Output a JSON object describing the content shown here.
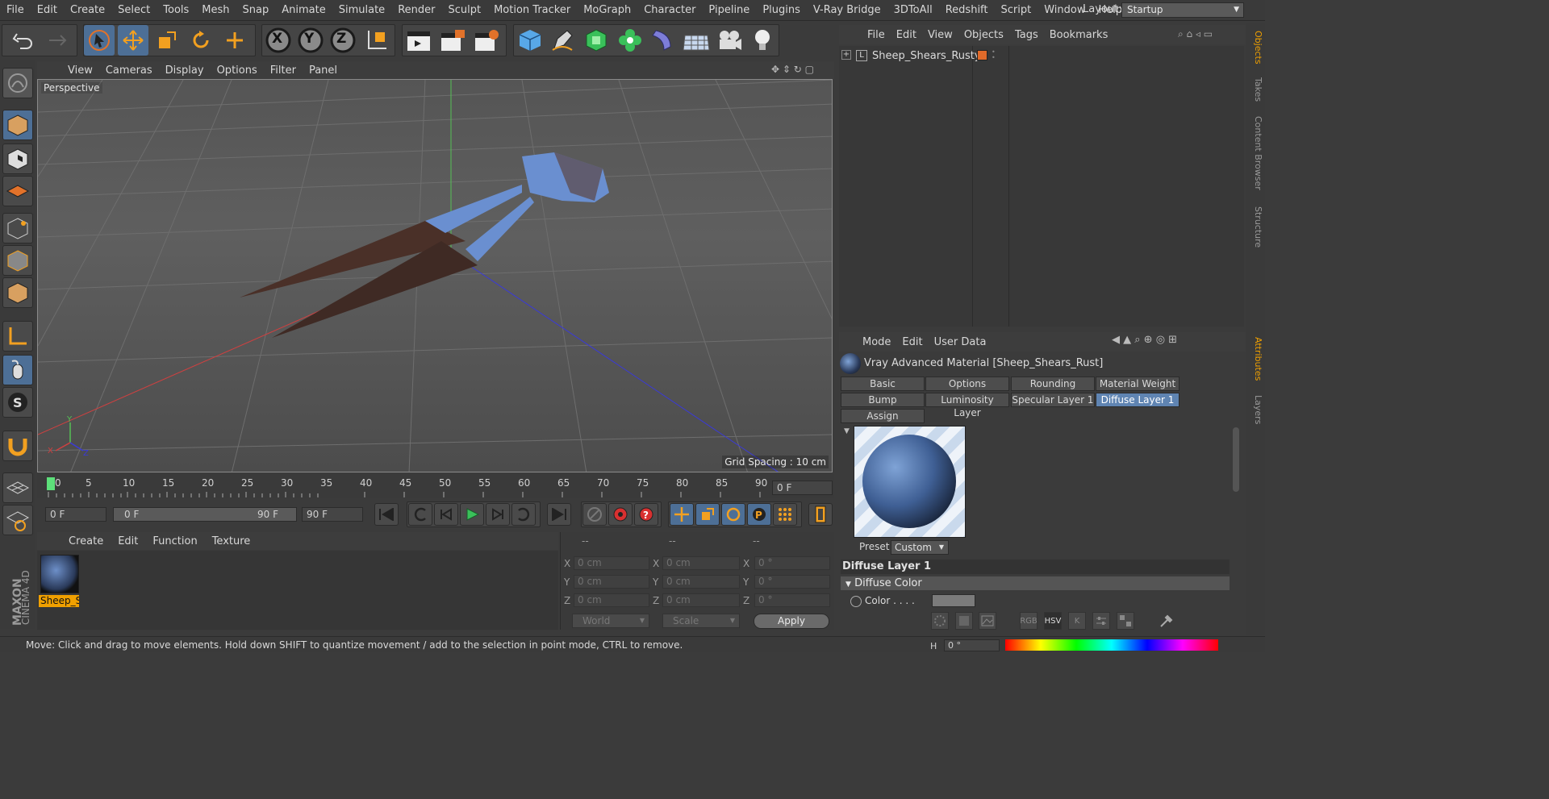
{
  "menubar": {
    "items": [
      "File",
      "Edit",
      "Create",
      "Select",
      "Tools",
      "Mesh",
      "Snap",
      "Animate",
      "Simulate",
      "Render",
      "Sculpt",
      "Motion Tracker",
      "MoGraph",
      "Character",
      "Pipeline",
      "Plugins",
      "V-Ray Bridge",
      "3DToAll",
      "Redshift",
      "Script",
      "Window",
      "Help"
    ],
    "layout_label": "Layout:",
    "layout_value": "Startup"
  },
  "toolbar": {
    "axis_x": "X",
    "axis_y": "Y",
    "axis_z": "Z"
  },
  "viewport": {
    "menu": [
      "View",
      "Cameras",
      "Display",
      "Options",
      "Filter",
      "Panel"
    ],
    "camera_label": "Perspective",
    "grid_spacing": "Grid Spacing : 10 cm"
  },
  "timeline": {
    "ticks": [
      "0",
      "5",
      "10",
      "15",
      "20",
      "25",
      "30",
      "35",
      "40",
      "45",
      "50",
      "55",
      "60",
      "65",
      "70",
      "75",
      "80",
      "85",
      "90"
    ],
    "current_frame": "0 F",
    "start_field": "0 F",
    "range_start": "0 F",
    "range_end": "90 F",
    "end_field": "90 F"
  },
  "material_manager": {
    "menu": [
      "Create",
      "Edit",
      "Function",
      "Texture"
    ],
    "material_name": "Sheep_S"
  },
  "coordinates": {
    "headers": [
      "--",
      "--",
      "--"
    ],
    "row_labels": [
      "X",
      "Y",
      "Z"
    ],
    "pos": [
      "0 cm",
      "0 cm",
      "0 cm"
    ],
    "size": [
      "0 cm",
      "0 cm",
      "0 cm"
    ],
    "rot": [
      "0 °",
      "0 °",
      "0 °"
    ],
    "mode_dropdown": "World",
    "size_dropdown": "Scale",
    "apply_label": "Apply"
  },
  "object_manager": {
    "menu": [
      "File",
      "Edit",
      "View",
      "Objects",
      "Tags",
      "Bookmarks"
    ],
    "object_name": "Sheep_Shears_Rusty"
  },
  "attributes": {
    "menu": [
      "Mode",
      "Edit",
      "User Data"
    ],
    "title": "Vray Advanced Material [Sheep_Shears_Rust]",
    "tabs_row1": [
      "Basic",
      "Options",
      "Rounding",
      "Material Weight"
    ],
    "tabs_row2": [
      "Bump",
      "Luminosity Layer",
      "Specular Layer 1",
      "Diffuse Layer 1"
    ],
    "tabs_row3": [
      "Assign"
    ],
    "active_tab": "Diffuse Layer 1",
    "preset_label": "Preset",
    "preset_value": "Custom",
    "section_title": "Diffuse Layer 1",
    "subsection_title": "Diffuse Color",
    "color_label": "Color . . . .",
    "color_buttons": [
      "RGB",
      "HSV",
      "K"
    ],
    "h_label": "H",
    "h_value": "0 °"
  },
  "right_tabs": [
    "Objects",
    "Takes",
    "Content Browser",
    "Structure",
    "Attributes",
    "Layers"
  ],
  "status": {
    "text": "Move: Click and drag to move elements. Hold down SHIFT to quantize movement / add to the selection in point mode, CTRL to remove."
  },
  "brand": {
    "logo_text_1": "MAXON",
    "logo_text_2": "CINEMA 4D"
  },
  "colors": {
    "selection_blue": "#4d6f96",
    "active_tab": "#5f84b2",
    "material_highlight": "#f0a000",
    "object_swatch": "#e06a2a"
  }
}
